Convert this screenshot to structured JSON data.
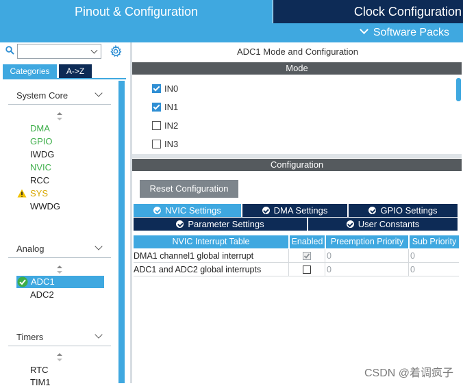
{
  "header": {
    "tabs": [
      {
        "label": "Pinout & Configuration",
        "active": true
      },
      {
        "label": "Clock Configuration",
        "active": false
      }
    ],
    "software_packs": "Software Packs"
  },
  "sidebar": {
    "search": {
      "value": "",
      "placeholder": ""
    },
    "view_tabs": [
      {
        "label": "Categories",
        "active": true
      },
      {
        "label": "A->Z",
        "active": false
      }
    ],
    "categories": [
      {
        "name": "System Core",
        "items": [
          {
            "label": "DMA",
            "status": "configured"
          },
          {
            "label": "GPIO",
            "status": "configured"
          },
          {
            "label": "IWDG",
            "status": "none"
          },
          {
            "label": "NVIC",
            "status": "configured"
          },
          {
            "label": "RCC",
            "status": "none"
          },
          {
            "label": "SYS",
            "status": "warning"
          },
          {
            "label": "WWDG",
            "status": "none"
          }
        ]
      },
      {
        "name": "Analog",
        "items": [
          {
            "label": "ADC1",
            "status": "selected"
          },
          {
            "label": "ADC2",
            "status": "none"
          }
        ]
      },
      {
        "name": "Timers",
        "items": [
          {
            "label": "RTC",
            "status": "none"
          },
          {
            "label": "TIM1",
            "status": "none"
          }
        ]
      }
    ]
  },
  "main": {
    "title": "ADC1 Mode and Configuration",
    "mode_header": "Mode",
    "mode_options": [
      {
        "label": "IN0",
        "checked": true
      },
      {
        "label": "IN1",
        "checked": true
      },
      {
        "label": "IN2",
        "checked": false
      },
      {
        "label": "IN3",
        "checked": false
      }
    ],
    "config_header": "Configuration",
    "reset_label": "Reset Configuration",
    "tabs_row1": [
      {
        "label": "NVIC Settings",
        "active": true
      },
      {
        "label": "DMA Settings",
        "active": false
      },
      {
        "label": "GPIO Settings",
        "active": false
      }
    ],
    "tabs_row2": [
      {
        "label": "Parameter Settings",
        "active": false
      },
      {
        "label": "User Constants",
        "active": false
      }
    ],
    "table": {
      "headers": [
        "NVIC Interrupt Table",
        "Enabled",
        "Preemption Priority",
        "Sub Priority"
      ],
      "rows": [
        {
          "name": "DMA1 channel1 global interrupt",
          "enabled": true,
          "enabled_locked": true,
          "preemption": "0",
          "sub": "0"
        },
        {
          "name": "ADC1 and ADC2 global interrupts",
          "enabled": false,
          "enabled_locked": false,
          "preemption": "0",
          "sub": "0"
        }
      ]
    }
  },
  "watermark": "CSDN @着调疯子",
  "colors": {
    "accent": "#3fa8e0",
    "dark_navy": "#0d2b56",
    "header_gray": "#555a5e",
    "configured_green": "#3dae49",
    "button_gray": "#7d858c"
  }
}
